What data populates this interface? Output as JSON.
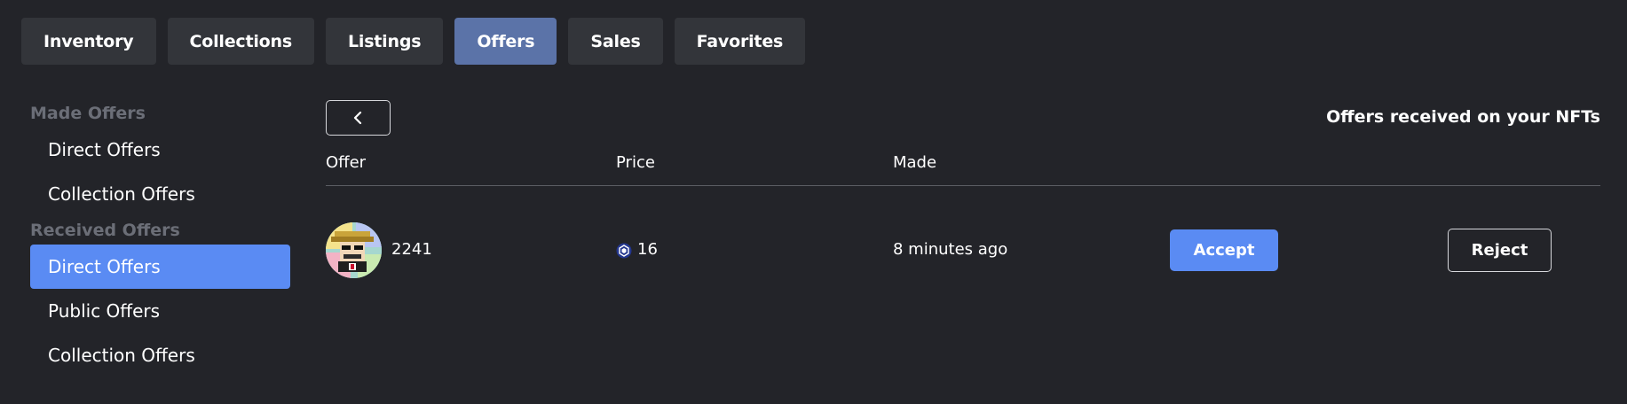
{
  "tabs": [
    {
      "label": "Inventory",
      "active": false
    },
    {
      "label": "Collections",
      "active": false
    },
    {
      "label": "Listings",
      "active": false
    },
    {
      "label": "Offers",
      "active": true
    },
    {
      "label": "Sales",
      "active": false
    },
    {
      "label": "Favorites",
      "active": false
    }
  ],
  "sidebar": {
    "made_section": "Made Offers",
    "made_items": [
      "Direct Offers",
      "Collection Offers"
    ],
    "received_section": "Received Offers",
    "received_items": [
      "Direct Offers",
      "Public Offers",
      "Collection Offers"
    ],
    "active_item": "Received Offers / Direct Offers"
  },
  "main": {
    "title": "Offers received on your NFTs",
    "columns": {
      "offer": "Offer",
      "price": "Price",
      "made": "Made"
    },
    "rows": [
      {
        "token_id": "2241",
        "price": "16",
        "made": "8 minutes ago",
        "accept_label": "Accept",
        "reject_label": "Reject"
      }
    ]
  },
  "colors": {
    "background": "#232429",
    "tab_bg": "#33353a",
    "tab_active": "#5b73a8",
    "accent": "#5a8bf3",
    "muted_text": "#6b6e77"
  },
  "icons": {
    "back": "chevron-left-icon",
    "price": "cronos-coin-icon"
  }
}
